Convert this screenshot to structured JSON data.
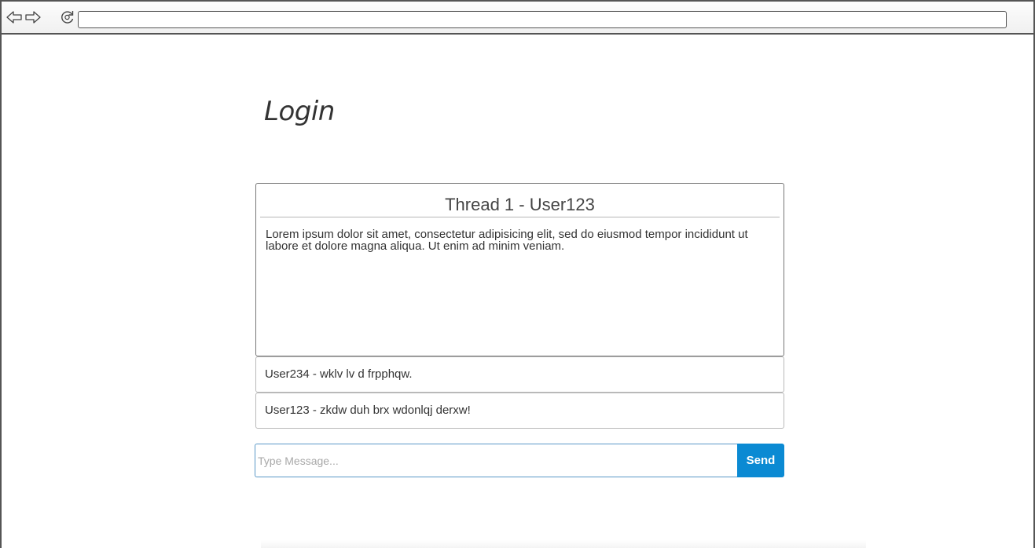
{
  "browser": {
    "url": "",
    "icons": {
      "back": "back-arrow-icon",
      "forward": "forward-arrow-icon",
      "reload": "reload-icon"
    }
  },
  "page": {
    "title": "Login"
  },
  "thread": {
    "title": "Thread 1 - User123",
    "body": "Lorem ipsum dolor sit amet, consectetur adipisicing elit, sed do eiusmod tempor incididunt ut labore et dolore magna aliqua. Ut enim ad minim veniam."
  },
  "replies": [
    {
      "text": "User234 - wklv lv d frpphqw."
    },
    {
      "text": "User123 - zkdw duh brx wdonlqj derxw!"
    }
  ],
  "composer": {
    "placeholder": "Type Message...",
    "value": "",
    "send_label": "Send"
  },
  "colors": {
    "accent": "#0b8ad3",
    "input_border": "#5a98c7",
    "frame": "#555555"
  }
}
